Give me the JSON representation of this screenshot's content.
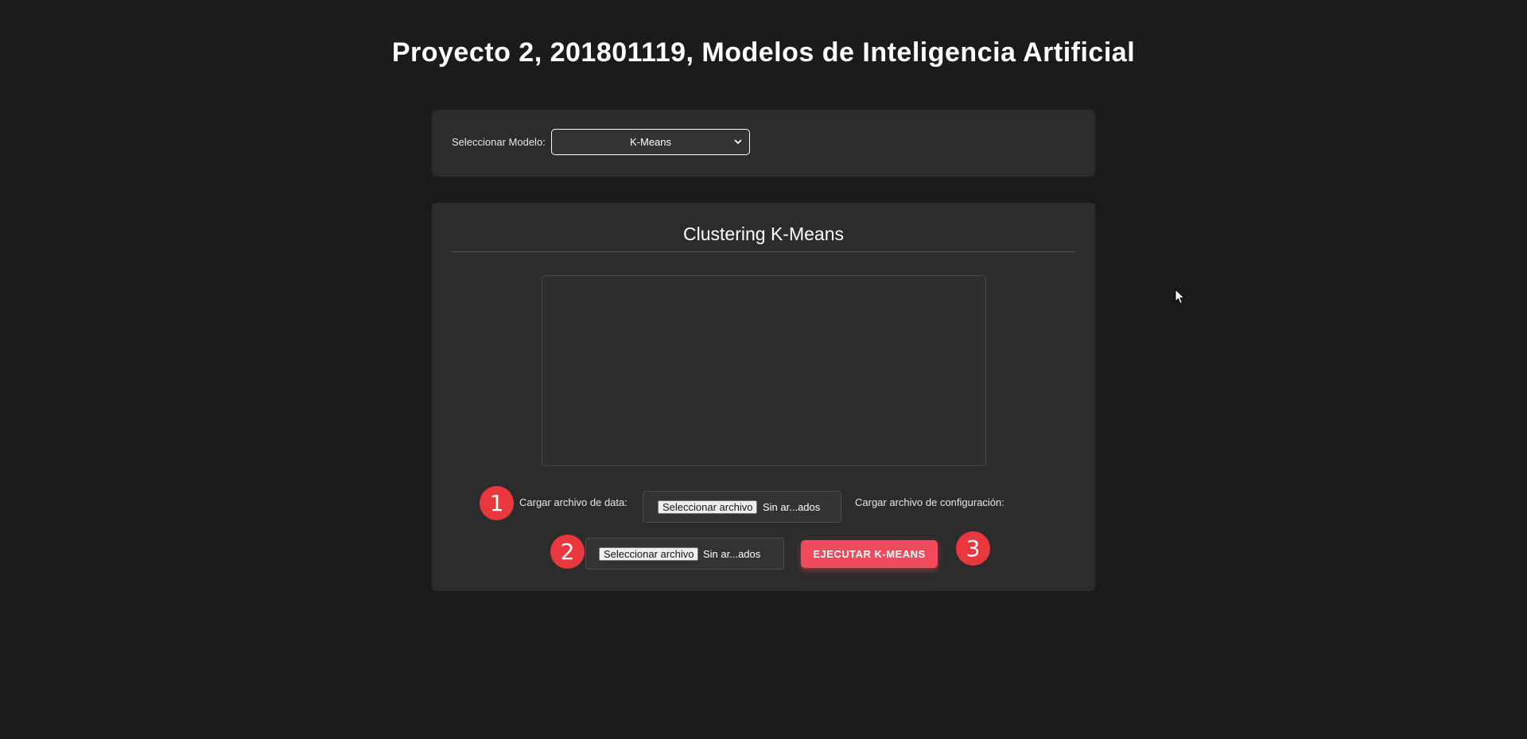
{
  "header": {
    "title": "Proyecto 2, 201801119, Modelos de Inteligencia Artificial"
  },
  "model_selector": {
    "label": "Seleccionar Modelo:",
    "selected": "K-Means"
  },
  "main": {
    "section_title": "Clustering K-Means",
    "steps": {
      "one": "1",
      "two": "2",
      "three": "3"
    },
    "data_file": {
      "label": "Cargar archivo de data:",
      "button": "Seleccionar archivo",
      "status": "Sin ar...ados"
    },
    "config_file": {
      "label": "Cargar archivo de configuración:",
      "button": "Seleccionar archivo",
      "status": "Sin ar...ados"
    },
    "run_button": "EJECUTAR K-MEANS"
  },
  "colors": {
    "background": "#1b1b1b",
    "card": "#2c2c2c",
    "accent": "#f14a5c",
    "badge": "#e8383d"
  },
  "icons": {
    "select_chevron": "chevron-down-icon",
    "pointer": "mouse-cursor-icon"
  }
}
